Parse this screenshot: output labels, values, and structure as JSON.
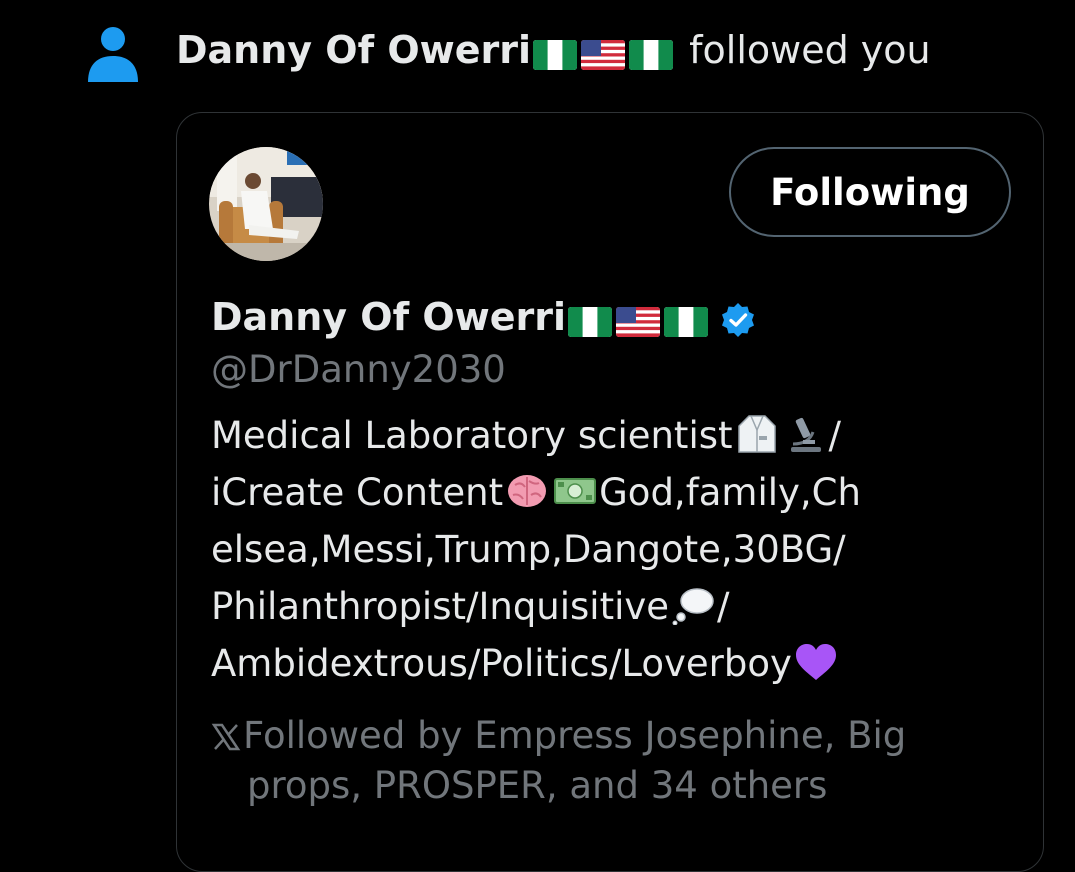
{
  "notification": {
    "icon": "person-icon",
    "follower_name": "Danny Of Owerri",
    "action_text": "followed you"
  },
  "card": {
    "follow_button_label": "Following",
    "display_name": "Danny Of Owerri",
    "verified_icon": "verified-badge-icon",
    "handle": "@DrDanny2030",
    "bio_lines": [
      "Medical Laboratory scientist",
      "/",
      "iCreate Content",
      "God,family,Ch",
      "elsea,Messi,Trump,Dangote,30BG/",
      "Philanthropist/Inquisitive",
      "/",
      "Ambidextrous/Politics/Loverboy"
    ],
    "followed_by": {
      "icon": "x-logo-icon",
      "line1": "Followed by Empress Josephine, Big",
      "line2": "props, PROSPER, and 34 others"
    }
  },
  "colors": {
    "background": "#000000",
    "text_primary": "#e7e9ea",
    "text_secondary": "#71767b",
    "accent_blue": "#1d9bf0",
    "border": "#2f3336"
  }
}
